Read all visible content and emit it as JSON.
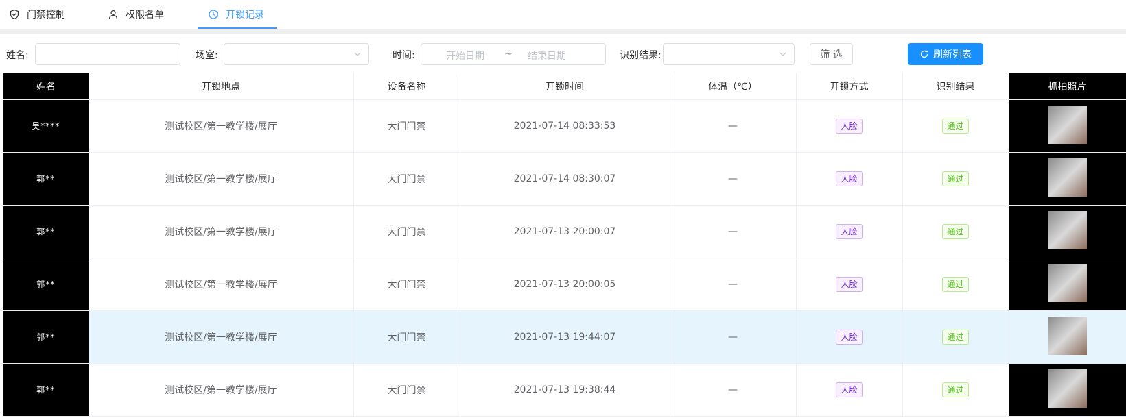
{
  "tabs": [
    {
      "label": "门禁控制",
      "icon": "shield-check-icon"
    },
    {
      "label": "权限名单",
      "icon": "user-icon"
    },
    {
      "label": "开锁记录",
      "icon": "clock-icon"
    }
  ],
  "filters": {
    "name_label": "姓名:",
    "room_label": "场室:",
    "time_label": "时间:",
    "start_placeholder": "开始日期",
    "range_sep": "~",
    "end_placeholder": "结束日期",
    "result_label": "识别结果:",
    "filter_button": "筛 选",
    "refresh_button": "刷新列表"
  },
  "table": {
    "columns": [
      "姓名",
      "开锁地点",
      "设备名称",
      "开锁时间",
      "体温（℃）",
      "开锁方式",
      "识别结果",
      "抓拍照片"
    ],
    "rows": [
      {
        "name": "吴****",
        "location": "测试校区/第一教学楼/展厅",
        "device": "大门门禁",
        "time": "2021-07-14 08:33:53",
        "temp": "—",
        "method": "人脸",
        "result": "通过"
      },
      {
        "name": "郭**",
        "location": "测试校区/第一教学楼/展厅",
        "device": "大门门禁",
        "time": "2021-07-14 08:30:07",
        "temp": "—",
        "method": "人脸",
        "result": "通过"
      },
      {
        "name": "郭**",
        "location": "测试校区/第一教学楼/展厅",
        "device": "大门门禁",
        "time": "2021-07-13 20:00:07",
        "temp": "—",
        "method": "人脸",
        "result": "通过"
      },
      {
        "name": "郭**",
        "location": "测试校区/第一教学楼/展厅",
        "device": "大门门禁",
        "time": "2021-07-13 20:00:05",
        "temp": "—",
        "method": "人脸",
        "result": "通过"
      },
      {
        "name": "郭**",
        "location": "测试校区/第一教学楼/展厅",
        "device": "大门门禁",
        "time": "2021-07-13 19:44:07",
        "temp": "—",
        "method": "人脸",
        "result": "通过"
      },
      {
        "name": "郭**",
        "location": "测试校区/第一教学楼/展厅",
        "device": "大门门禁",
        "time": "2021-07-13 19:38:44",
        "temp": "—",
        "method": "人脸",
        "result": "通过"
      }
    ]
  },
  "colors": {
    "accent": "#1890ff",
    "tab_active": "#409eff",
    "row_highlight": "#e6f4fd"
  }
}
